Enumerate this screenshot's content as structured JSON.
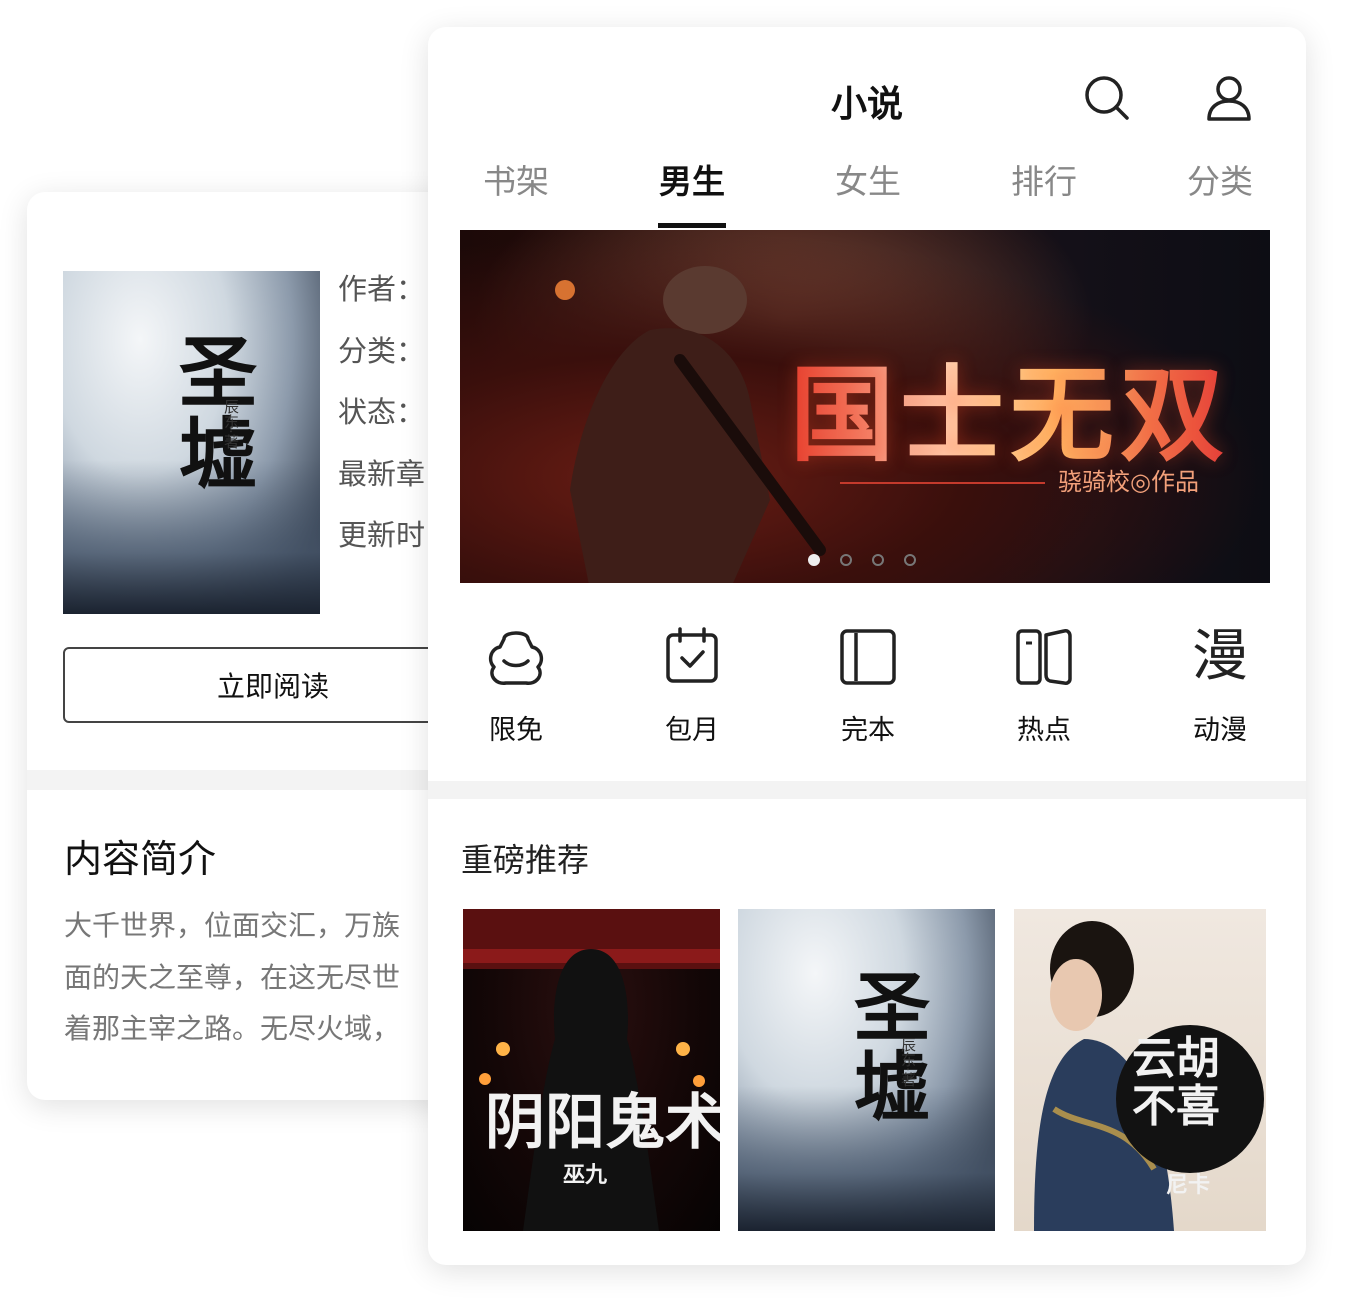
{
  "detail": {
    "meta_labels": [
      "作者：",
      "分类：",
      "状态：",
      "最新章",
      "更新时"
    ],
    "cover": {
      "title": "圣墟",
      "author": "辰东·著"
    },
    "read_button": "立即阅读",
    "intro_title": "内容简介",
    "intro_lines": [
      "大千世界，位面交汇，万族",
      "面的天之至尊，在这无尽世",
      "着那主宰之路。无尽火域，"
    ]
  },
  "home": {
    "title": "小说",
    "icons": {
      "search": "search-icon",
      "profile": "user-icon"
    },
    "tabs": [
      {
        "label": "书架",
        "active": false
      },
      {
        "label": "男生",
        "active": true
      },
      {
        "label": "女生",
        "active": false
      },
      {
        "label": "排行",
        "active": false
      },
      {
        "label": "分类",
        "active": false
      }
    ],
    "banner": {
      "title": "国士无双",
      "author": "骁骑校◎作品",
      "slide_count": 4,
      "active_slide": 1
    },
    "quick_menu": [
      {
        "label": "限免",
        "icon": "free-icon"
      },
      {
        "label": "包月",
        "icon": "calendar-check-icon"
      },
      {
        "label": "完本",
        "icon": "book-complete-icon"
      },
      {
        "label": "热点",
        "icon": "book-open-icon"
      },
      {
        "label": "动漫",
        "icon": "manga-icon"
      }
    ],
    "recommend_title": "重磅推荐",
    "recommend_books": [
      {
        "title": "阴阳鬼术",
        "author": "巫九"
      },
      {
        "title": "圣墟",
        "author": "辰东·著"
      },
      {
        "title": "云胡不喜",
        "author": "尼卡"
      }
    ]
  }
}
